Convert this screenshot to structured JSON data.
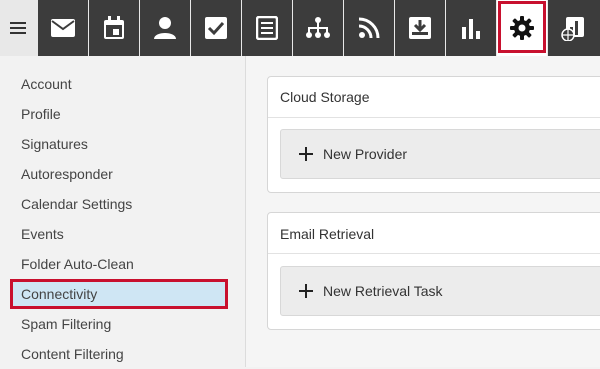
{
  "toolbar": {
    "items": [
      {
        "icon": "mail-icon"
      },
      {
        "icon": "calendar-icon"
      },
      {
        "icon": "contacts-icon"
      },
      {
        "icon": "tasks-icon"
      },
      {
        "icon": "notes-icon"
      },
      {
        "icon": "network-icon"
      },
      {
        "icon": "rss-icon"
      },
      {
        "icon": "download-icon"
      },
      {
        "icon": "reports-icon"
      },
      {
        "icon": "gear-icon",
        "active": true
      },
      {
        "icon": "admin-chart-icon"
      }
    ]
  },
  "sidebar": {
    "items": [
      {
        "label": "Account"
      },
      {
        "label": "Profile"
      },
      {
        "label": "Signatures"
      },
      {
        "label": "Autoresponder"
      },
      {
        "label": "Calendar Settings"
      },
      {
        "label": "Events"
      },
      {
        "label": "Folder Auto-Clean"
      },
      {
        "label": "Connectivity",
        "selected": true
      },
      {
        "label": "Spam Filtering"
      },
      {
        "label": "Content Filtering"
      }
    ]
  },
  "main": {
    "cloud_storage": {
      "title": "Cloud Storage",
      "button_label": "New Provider"
    },
    "email_retrieval": {
      "title": "Email Retrieval",
      "button_label": "New Retrieval Task"
    }
  },
  "colors": {
    "toolbar_bg": "#3c3c3c",
    "highlight": "#c8102e",
    "selected_bg": "#cfe6f4"
  }
}
